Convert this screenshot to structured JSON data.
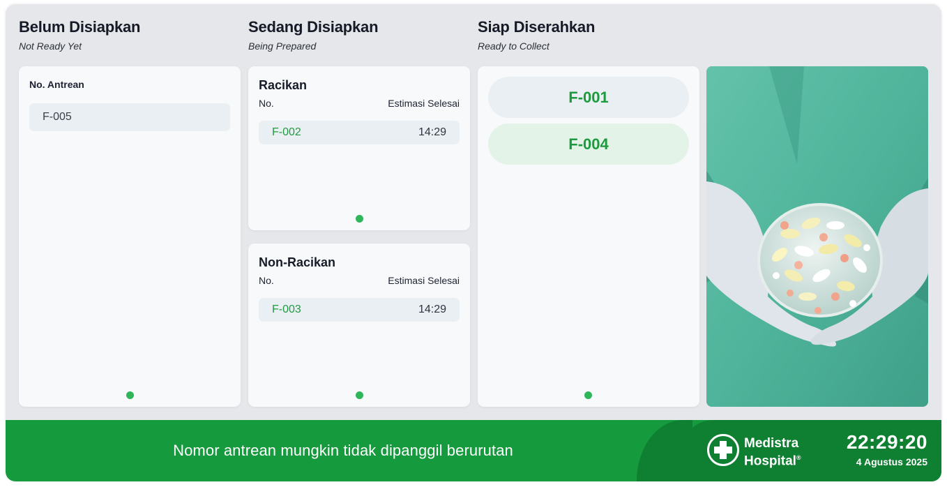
{
  "columns": {
    "not_ready": {
      "title": "Belum Disiapkan",
      "subtitle": "Not Ready Yet",
      "list_header": "No. Antrean",
      "items": [
        "F-005"
      ]
    },
    "preparing": {
      "title": "Sedang Disiapkan",
      "subtitle": "Being Prepared",
      "racikan": {
        "title": "Racikan",
        "col_no": "No.",
        "col_est": "Estimasi Selesai",
        "rows": [
          {
            "no": "F-002",
            "time": "14:29"
          }
        ]
      },
      "non_racikan": {
        "title": "Non-Racikan",
        "col_no": "No.",
        "col_est": "Estimasi Selesai",
        "rows": [
          {
            "no": "F-003",
            "time": "14:29"
          }
        ]
      }
    },
    "ready": {
      "title": "Siap Diserahkan",
      "subtitle": "Ready to Collect",
      "items": [
        "F-001",
        "F-004"
      ]
    }
  },
  "footer": {
    "message": "Nomor antrean mungkin tidak dipanggil berurutan",
    "brand_line1": "Medistra",
    "brand_line2": "Hospital",
    "brand_mark": "®",
    "time": "22:29:20",
    "date": "4 Agustus 2025"
  },
  "colors": {
    "accent_green": "#159a3d",
    "dark_green": "#0f7f32",
    "indicator_dot": "#2fb55a",
    "pill_neutral": "#e9eff2",
    "pill_highlight": "#e3f3e7"
  },
  "icons": {
    "logo": "medical-cross-icon",
    "status": "status-dot-icon"
  }
}
